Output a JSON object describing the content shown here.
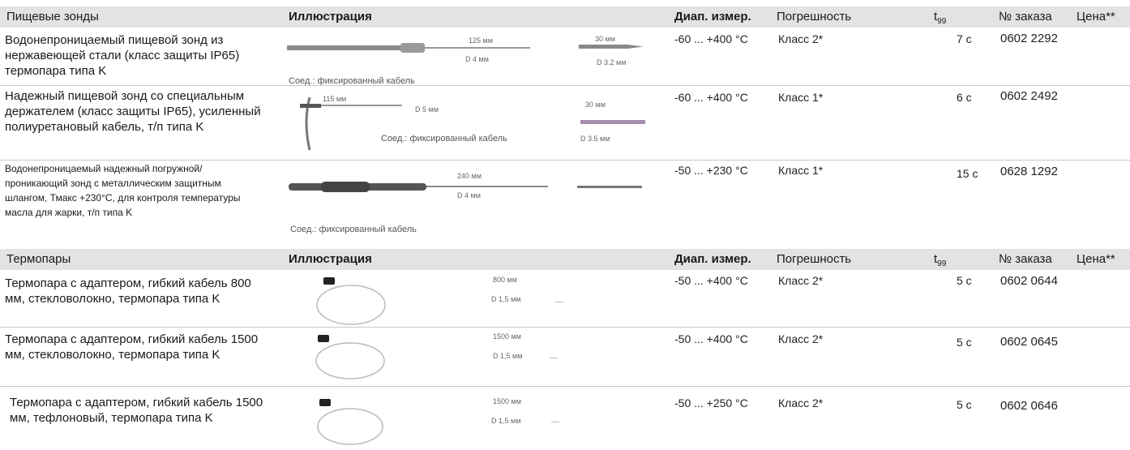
{
  "headers": {
    "illustration": "Иллюстрация",
    "range": "Диап. измер.",
    "accuracy": "Погрешность",
    "t99_base": "t",
    "t99_sub": "99",
    "order": "№ заказа",
    "price": "Цена**"
  },
  "sections": [
    {
      "title": "Пищевые зонды",
      "rows": [
        {
          "description": "Водонепроницаемый пищевой зонд из нержавеющей стали (класс защиты IP65) термопара типа K",
          "range": "-60 ... +400 °C",
          "accuracy": "Класс 2*",
          "t99": "7 с",
          "order": "0602 2292",
          "dim_length": "125 мм",
          "dim_diameter": "D 4 мм",
          "tip_length": "30 мм",
          "tip_diameter": "D 3.2 мм",
          "cable": "Соед.: фиксированный кабель"
        },
        {
          "description": "Надежный пищевой зонд со специальным держателем (класс защиты IP65), усиленный полиуретановый кабель, т/п типа K",
          "range": "-60 ... +400 °C",
          "accuracy": "Класс 1*",
          "t99": "6 с",
          "order": "0602 2492",
          "dim_length": "115 мм",
          "dim_diameter": "D 5 мм",
          "tip_length": "30 мм",
          "tip_diameter": "D 3.5 мм",
          "cable": "Соед.: фиксированный кабель"
        },
        {
          "description": "Водонепроницаемый надежный погружной/проникающий зонд с металлическим защитным шлангом, Тмакс +230°C, для контроля температуры масла для жарки, т/п типа K",
          "range": "-50 ... +230 °C",
          "accuracy": "Класс 1*",
          "t99": "15 с",
          "order": "0628 1292",
          "dim_length": "240 мм",
          "dim_diameter": "D 4 мм",
          "cable": "Соед.: фиксированный кабель"
        }
      ]
    },
    {
      "title": "Термопары",
      "rows": [
        {
          "description": "Термопара с адаптером, гибкий кабель 800 мм, стекловолокно, термопара типа K",
          "range": "-50 ... +400 °C",
          "accuracy": "Класс 2*",
          "t99": "5 с",
          "order": "0602 0644",
          "dim_length": "800 мм",
          "dim_diameter": "D 1,5 мм"
        },
        {
          "description": "Термопара с адаптером, гибкий кабель 1500 мм, стекловолокно, термопара типа K",
          "range": "-50 ... +400 °C",
          "accuracy": "Класс 2*",
          "t99": "5 с",
          "order": "0602 0645",
          "dim_length": "1500 мм",
          "dim_diameter": "D 1,5 мм"
        },
        {
          "description": "Термопара с адаптером, гибкий кабель 1500 мм, тефлоновый, термопара типа K",
          "range": "-50 ... +250 °C",
          "accuracy": "Класс 2*",
          "t99": "5 с",
          "order": "0602 0646",
          "dim_length": "1500 мм",
          "dim_diameter": "D 1,5 мм"
        }
      ]
    }
  ]
}
